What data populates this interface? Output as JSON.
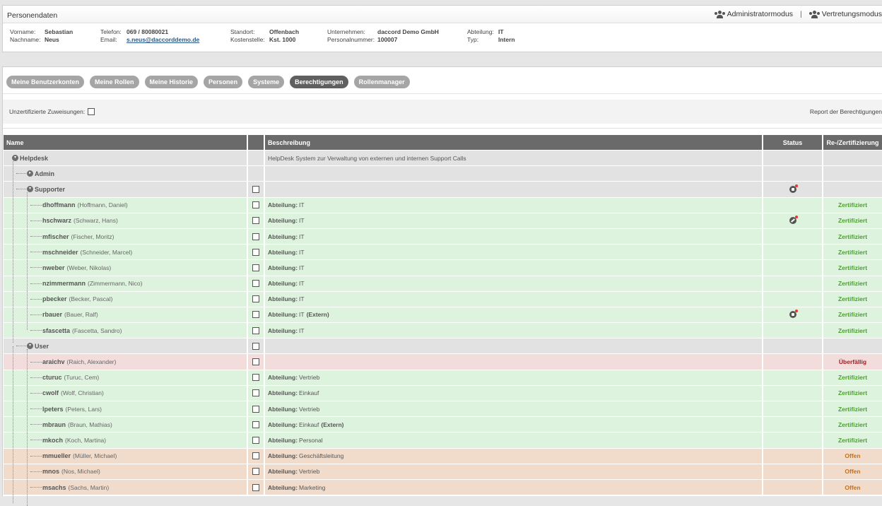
{
  "person_panel": {
    "title": "Personendaten",
    "admin_mode": "Administratormodus",
    "separator": "|",
    "proxy_mode": "Vertretungsmodus",
    "fields": {
      "vorname_label": "Vorname:",
      "vorname": "Sebastian",
      "nachname_label": "Nachname:",
      "nachname": "Neus",
      "telefon_label": "Telefon:",
      "telefon": "069 / 80080021",
      "email_label": "Email:",
      "email": "s.neus@daccorddemo.de",
      "standort_label": "Standort:",
      "standort": "Offenbach",
      "kostenstelle_label": "Kostenstelle:",
      "kostenstelle": "Kst. 1000",
      "unternehmen_label": "Unternehmen:",
      "unternehmen": "daccord Demo GmbH",
      "personalnummer_label": "Personalnummer:",
      "personalnummer": "100007",
      "abteilung_label": "Abteilung:",
      "abteilung": "IT",
      "typ_label": "Typ:",
      "typ": "Intern"
    }
  },
  "tabs": [
    {
      "label": "Meine Benutzerkonten"
    },
    {
      "label": "Meine Rollen"
    },
    {
      "label": "Meine Historie"
    },
    {
      "label": "Personen"
    },
    {
      "label": "Systeme"
    },
    {
      "label": "Berechtigungen",
      "active": true
    },
    {
      "label": "Rollenmanager"
    }
  ],
  "filter": {
    "unzertifizierte_label": "Unzertifizierte Zuweisungen:",
    "report_label": "Report der Berechtigungen"
  },
  "table": {
    "headers": {
      "name": "Name",
      "chk": "",
      "desc": "Beschreibung",
      "status": "Status",
      "cert": "Re-/Zertifizierung"
    },
    "rows": [
      {
        "type": "root",
        "level": 0,
        "toggle": "minus",
        "name": "Helpdesk",
        "full": "",
        "desc_plain": "HelpDesk System zur Verwaltung von externen und internen Support Calls",
        "color": "gray",
        "checkbox": false,
        "status": "",
        "cert": ""
      },
      {
        "type": "group",
        "level": 1,
        "toggle": "plus",
        "name": "Admin",
        "full": "",
        "color": "gray",
        "checkbox": false,
        "status": "",
        "cert": ""
      },
      {
        "type": "group",
        "level": 1,
        "toggle": "minus",
        "name": "Supporter",
        "full": "",
        "color": "gray",
        "checkbox": true,
        "status": "lock-icon",
        "cert": ""
      },
      {
        "type": "leaf",
        "level": 2,
        "name": "dhoffmann",
        "full": "(Hoffmann, Daniel)",
        "desc_label": "Abteilung:",
        "desc_val": "IT",
        "color": "green",
        "checkbox": true,
        "status": "",
        "cert": "Zertifiziert",
        "cert_class": "ok"
      },
      {
        "type": "leaf",
        "level": 2,
        "name": "hschwarz",
        "full": "(Schwarz, Hans)",
        "desc_label": "Abteilung:",
        "desc_val": "IT",
        "color": "green",
        "checkbox": true,
        "status": "key-icon",
        "cert": "Zertifiziert",
        "cert_class": "ok"
      },
      {
        "type": "leaf",
        "level": 2,
        "name": "mfischer",
        "full": "(Fischer, Moritz)",
        "desc_label": "Abteilung:",
        "desc_val": "IT",
        "color": "green",
        "checkbox": true,
        "status": "",
        "cert": "Zertifiziert",
        "cert_class": "ok"
      },
      {
        "type": "leaf",
        "level": 2,
        "name": "mschneider",
        "full": "(Schneider, Marcel)",
        "desc_label": "Abteilung:",
        "desc_val": "IT",
        "color": "green",
        "checkbox": true,
        "status": "",
        "cert": "Zertifiziert",
        "cert_class": "ok"
      },
      {
        "type": "leaf",
        "level": 2,
        "name": "nweber",
        "full": "(Weber, Nikolas)",
        "desc_label": "Abteilung:",
        "desc_val": "IT",
        "color": "green",
        "checkbox": true,
        "status": "",
        "cert": "Zertifiziert",
        "cert_class": "ok"
      },
      {
        "type": "leaf",
        "level": 2,
        "name": "nzimmermann",
        "full": "(Zimmermann, Nico)",
        "desc_label": "Abteilung:",
        "desc_val": "IT",
        "color": "green",
        "checkbox": true,
        "status": "",
        "cert": "Zertifiziert",
        "cert_class": "ok"
      },
      {
        "type": "leaf",
        "level": 2,
        "name": "pbecker",
        "full": "(Becker, Pascal)",
        "desc_label": "Abteilung:",
        "desc_val": "IT",
        "color": "green",
        "checkbox": true,
        "status": "",
        "cert": "Zertifiziert",
        "cert_class": "ok"
      },
      {
        "type": "leaf",
        "level": 2,
        "name": "rbauer",
        "full": "(Bauer, Ralf)",
        "desc_label": "Abteilung:",
        "desc_val": "IT",
        "desc_extra": "(Extern)",
        "color": "green",
        "checkbox": true,
        "status": "lock-icon",
        "cert": "Zertifiziert",
        "cert_class": "ok"
      },
      {
        "type": "leaf",
        "level": 2,
        "name": "sfascetta",
        "full": "(Fascetta, Sandro)",
        "desc_label": "Abteilung:",
        "desc_val": "IT",
        "color": "green",
        "checkbox": true,
        "status": "",
        "cert": "Zertifiziert",
        "cert_class": "ok"
      },
      {
        "type": "group",
        "level": 1,
        "toggle": "minus",
        "name": "User",
        "full": "",
        "color": "gray",
        "checkbox": true,
        "status": "",
        "cert": ""
      },
      {
        "type": "leaf",
        "level": 2,
        "name": "araichv",
        "full": "(Raich, Alexander)",
        "desc_label": "",
        "desc_val": "",
        "color": "red",
        "checkbox": true,
        "status": "",
        "cert": "Überfällig",
        "cert_class": "over"
      },
      {
        "type": "leaf",
        "level": 2,
        "name": "cturuc",
        "full": "(Turuc, Cem)",
        "desc_label": "Abteilung:",
        "desc_val": "Vertrieb",
        "color": "green",
        "checkbox": true,
        "status": "",
        "cert": "Zertifiziert",
        "cert_class": "ok"
      },
      {
        "type": "leaf",
        "level": 2,
        "name": "cwolf",
        "full": "(Wolf, Christian)",
        "desc_label": "Abteilung:",
        "desc_val": "Einkauf",
        "color": "green",
        "checkbox": true,
        "status": "",
        "cert": "Zertifiziert",
        "cert_class": "ok"
      },
      {
        "type": "leaf",
        "level": 2,
        "name": "lpeters",
        "full": "(Peters, Lars)",
        "desc_label": "Abteilung:",
        "desc_val": "Vertrieb",
        "color": "green",
        "checkbox": true,
        "status": "",
        "cert": "Zertifiziert",
        "cert_class": "ok"
      },
      {
        "type": "leaf",
        "level": 2,
        "name": "mbraun",
        "full": "(Braun, Mathias)",
        "desc_label": "Abteilung:",
        "desc_val": "Einkauf",
        "desc_extra": "(Extern)",
        "color": "green",
        "checkbox": true,
        "status": "",
        "cert": "Zertifiziert",
        "cert_class": "ok"
      },
      {
        "type": "leaf",
        "level": 2,
        "name": "mkoch",
        "full": "(Koch, Martina)",
        "desc_label": "Abteilung:",
        "desc_val": "Personal",
        "color": "green",
        "checkbox": true,
        "status": "",
        "cert": "Zertifiziert",
        "cert_class": "ok"
      },
      {
        "type": "leaf",
        "level": 2,
        "name": "mmueller",
        "full": "(Müller, Michael)",
        "desc_label": "Abteilung:",
        "desc_val": "Geschäftsleitung",
        "color": "orange",
        "checkbox": true,
        "status": "",
        "cert": "Offen",
        "cert_class": "open"
      },
      {
        "type": "leaf",
        "level": 2,
        "name": "mnos",
        "full": "(Nos, Michael)",
        "desc_label": "Abteilung:",
        "desc_val": "Vertrieb",
        "color": "orange",
        "checkbox": true,
        "status": "",
        "cert": "Offen",
        "cert_class": "open"
      },
      {
        "type": "leaf",
        "level": 2,
        "name": "msachs",
        "full": "(Sachs, Martin)",
        "desc_label": "Abteilung:",
        "desc_val": "Marketing",
        "color": "orange",
        "checkbox": true,
        "status": "",
        "cert": "Offen",
        "cert_class": "open"
      }
    ]
  }
}
